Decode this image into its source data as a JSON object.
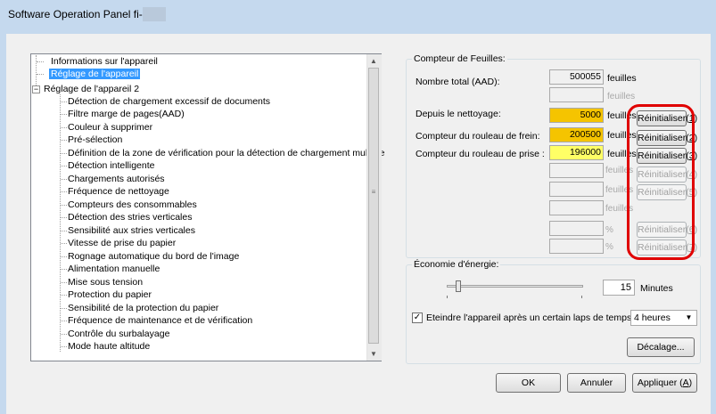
{
  "window": {
    "title": "Software Operation Panel fi-"
  },
  "tree": {
    "items": [
      "Informations sur l'appareil",
      "Réglage de l'appareil",
      "Réglage de l'appareil 2",
      "Détection de chargement excessif de documents",
      "Filtre marge de pages(AAD)",
      "Couleur à supprimer",
      "Pré-sélection",
      "Définition de la zone de vérification pour la détection de chargement multiple",
      "Détection intelligente",
      "Chargements autorisés",
      "Fréquence de nettoyage",
      "Compteurs des consommables",
      "Détection des stries verticales",
      "Sensibilité aux stries verticales",
      "Vitesse de prise du papier",
      "Rognage automatique du bord de l'image",
      "Alimentation manuelle",
      "Mise sous tension",
      "Protection du papier",
      "Sensibilité de la protection du papier",
      "Fréquence de maintenance et de vérification",
      "Contrôle du surbalayage",
      "Mode haute altitude"
    ],
    "expander": "−",
    "scroll_up": "▲",
    "scroll_down": "▼",
    "scroll_grip": "≡"
  },
  "compteur": {
    "title": "Compteur de Feuilles:",
    "total_label": "Nombre total (AAD):",
    "total_value": "500055",
    "total_unit": "feuilles",
    "disabled_unit": "feuilles",
    "nettoyage_label": "Depuis le nettoyage:",
    "nettoyage_value": "5000",
    "nettoyage_unit": "feuilles",
    "frein_label": "Compteur du rouleau de frein:",
    "frein_value": "200500",
    "frein_unit": "feuilles",
    "prise_label": "Compteur du rouleau de prise :",
    "prise_value": "196000",
    "prise_unit": "feuilles",
    "dis_unit_a": "feuilles",
    "dis_unit_b": "feuilles",
    "dis_unit_c": "feuilles",
    "pct_a": "%",
    "pct_b": "%",
    "reset1_pre": "Réinitialiser(",
    "reset1_key": "1",
    "reset2_pre": "Réinitialiser(",
    "reset2_key": "2",
    "reset3_pre": "Réinitialiser(",
    "reset3_key": "3",
    "reset4_pre": "Réinitialiser(",
    "reset4_key": "4",
    "reset5_pre": "Réinitialiser(",
    "reset5_key": "5",
    "reset6_pre": "Réinitialiser(",
    "reset6_key": "6",
    "reset7_pre": "Réinitialiser(",
    "reset7_key": "7",
    "close_paren": ")",
    "colors": {
      "nettoyage": "#f5c400",
      "frein": "#f5c400",
      "prise": "#ffff66",
      "highlight": "#e00000"
    }
  },
  "energie": {
    "title": "Économie d'énergie:",
    "minutes_value": "15",
    "minutes_label": "Minutes",
    "checkbox_label": "Eteindre l'appareil après un certain laps de temps",
    "checkbox_mark": "✓",
    "select_value": "4 heures",
    "select_arrow": "▼",
    "decalage_label": "Décalage..."
  },
  "footer": {
    "ok": "OK",
    "annuler": "Annuler",
    "appliquer_pre": "Appliquer (",
    "appliquer_key": "A",
    "appliquer_post": ")"
  }
}
